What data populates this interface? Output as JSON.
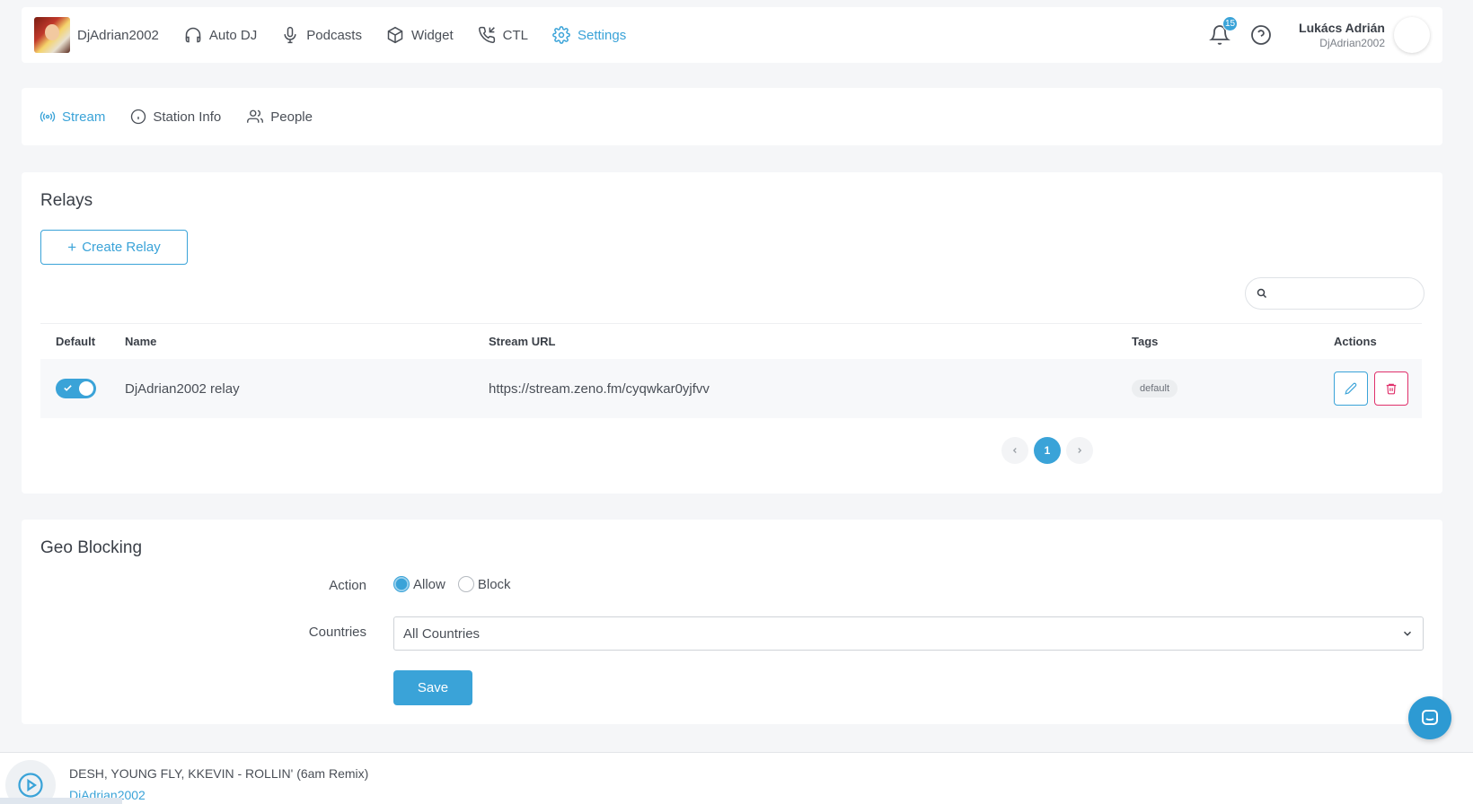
{
  "topbar": {
    "brand_name": "DjAdrian2002",
    "nav": [
      {
        "label": "Auto DJ",
        "icon": "headphones-icon"
      },
      {
        "label": "Podcasts",
        "icon": "microphone-icon"
      },
      {
        "label": "Widget",
        "icon": "cube-icon"
      },
      {
        "label": "CTL",
        "icon": "phone-incoming-icon"
      },
      {
        "label": "Settings",
        "icon": "gear-icon",
        "active": true
      }
    ],
    "notifications_count": "15",
    "user_name": "Lukács Adrián",
    "user_handle": "DjAdrian2002"
  },
  "settings_tabs": [
    {
      "label": "Stream",
      "icon": "broadcast-icon",
      "active": true
    },
    {
      "label": "Station Info",
      "icon": "info-icon"
    },
    {
      "label": "People",
      "icon": "people-icon"
    }
  ],
  "relays": {
    "title": "Relays",
    "create_label": "Create Relay",
    "search_placeholder": "",
    "columns": [
      "Default",
      "Name",
      "Stream URL",
      "Tags",
      "Actions"
    ],
    "rows": [
      {
        "default": true,
        "name": "DjAdrian2002 relay",
        "stream_url": "https://stream.zeno.fm/cyqwkar0yjfvv",
        "tag": "default"
      }
    ],
    "pagination": {
      "current": "1"
    }
  },
  "geo": {
    "title": "Geo Blocking",
    "action_label": "Action",
    "options": [
      "Allow",
      "Block"
    ],
    "selected_option": "Allow",
    "countries_label": "Countries",
    "countries_value": "All Countries",
    "save_label": "Save"
  },
  "player": {
    "track": "DESH, YOUNG FLY, KKEVIN - ROLLIN' (6am Remix)",
    "artist": "DjAdrian2002"
  },
  "colors": {
    "accent": "#3aa3d8",
    "danger": "#e0306b"
  }
}
